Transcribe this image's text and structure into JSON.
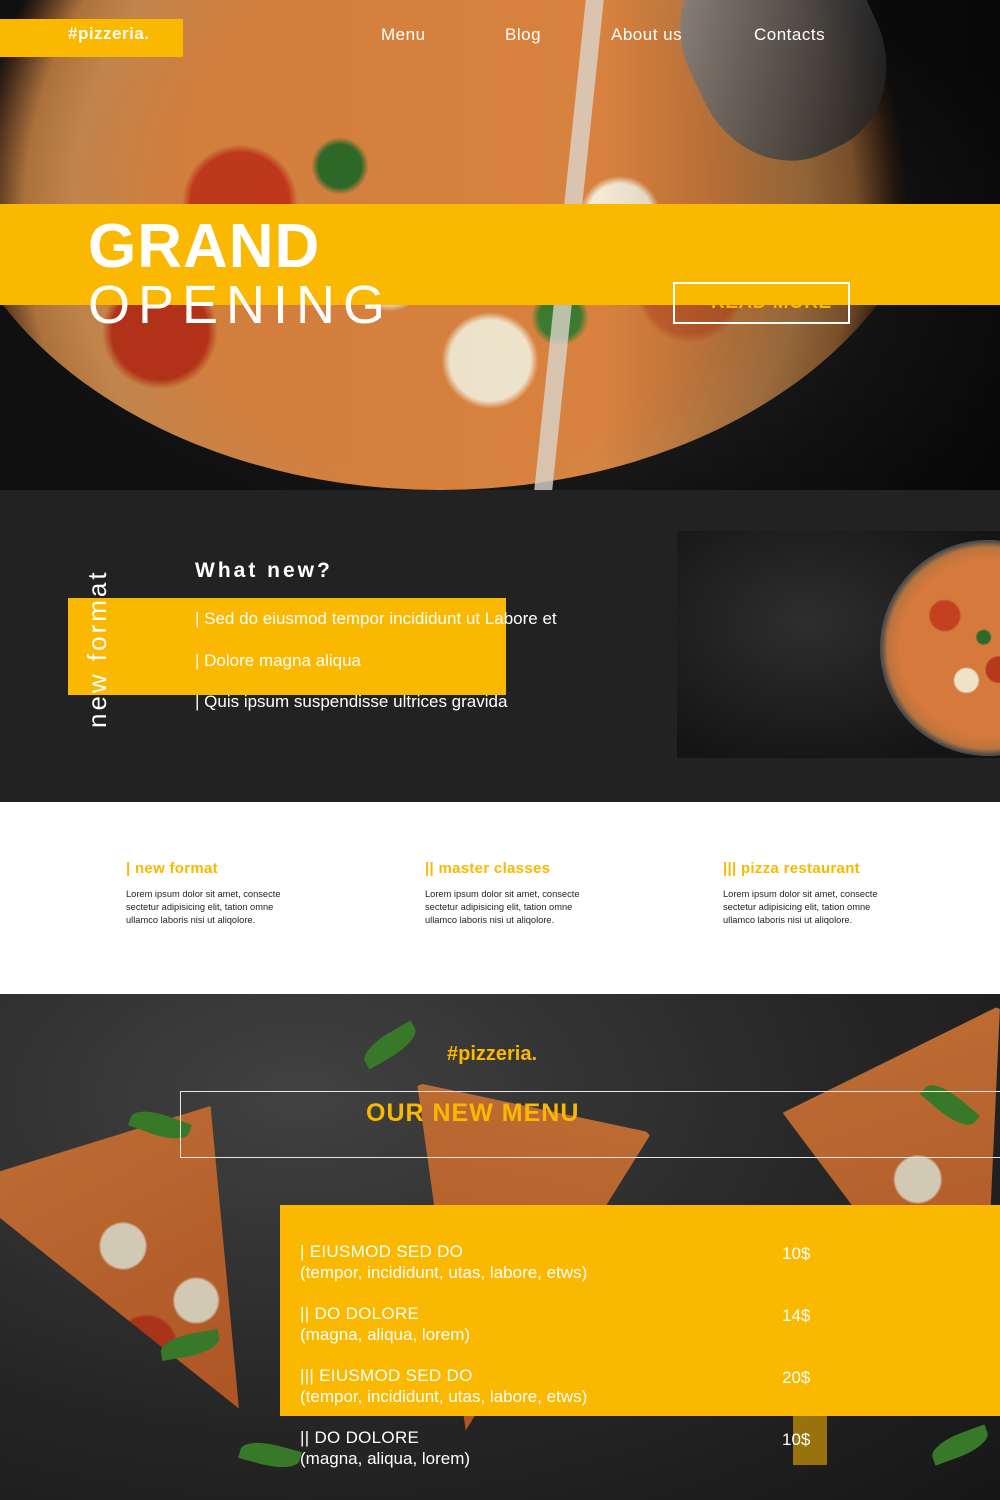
{
  "brand": {
    "logo": "#pizzeria.",
    "accent": "#fbb800"
  },
  "nav": {
    "items": [
      "Menu",
      "Blog",
      "About us",
      "Contacts"
    ]
  },
  "hero": {
    "title": "GRAND",
    "subtitle": "OPENING",
    "cta": "READ MORE"
  },
  "what_new": {
    "side_label": "new format",
    "title": "What new?",
    "items": [
      "|  Sed do eiusmod tempor incididunt ut Labore et",
      "|  Dolore magna aliqua",
      "|  Quis ipsum suspendisse ultrices gravida"
    ]
  },
  "features": [
    {
      "title": "| new format",
      "body": "Lorem ipsum dolor sit amet, consecte sectetur adipisicing elit, tation omne ullamco laboris nisi ut aliqolore."
    },
    {
      "title": "|| master classes",
      "body": "Lorem ipsum dolor sit amet, consecte sectetur adipisicing elit, tation omne ullamco laboris nisi ut aliqolore."
    },
    {
      "title": "||| pizza restaurant",
      "body": "Lorem ipsum dolor sit amet, consecte sectetur adipisicing elit, tation omne ullamco laboris nisi ut aliqolore."
    }
  ],
  "menu": {
    "logo": "#pizzeria.",
    "heading": "OUR NEW MENU",
    "items": [
      {
        "name": "|  EIUSMOD SED DO",
        "desc": "(tempor, incididunt, utas, labore, etws)",
        "price": "10$"
      },
      {
        "name": "||  DO DOLORE",
        "desc": "(magna, aliqua, lorem)",
        "price": "14$"
      },
      {
        "name": "|||  EIUSMOD SED DO",
        "desc": "(tempor, incididunt, utas, labore, etws)",
        "price": "20$"
      },
      {
        "name": "||  DO DOLORE",
        "desc": "(magna, aliqua, lorem)",
        "price": "10$"
      }
    ]
  }
}
